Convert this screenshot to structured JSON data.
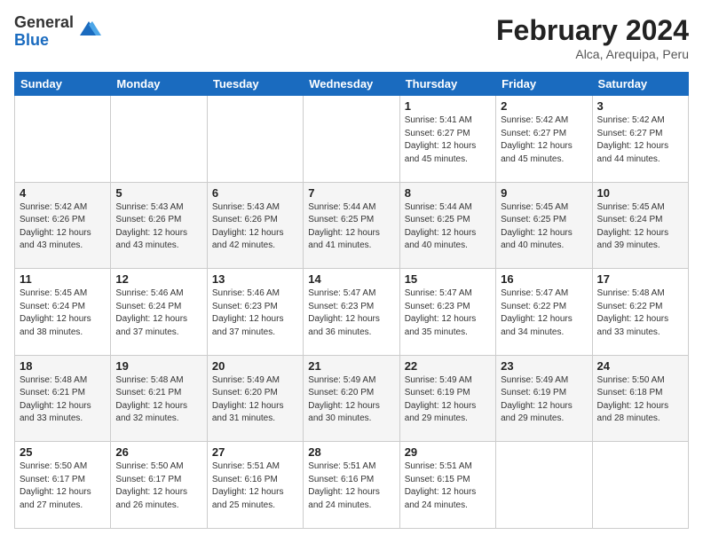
{
  "logo": {
    "general": "General",
    "blue": "Blue"
  },
  "title": "February 2024",
  "subtitle": "Alca, Arequipa, Peru",
  "days_of_week": [
    "Sunday",
    "Monday",
    "Tuesday",
    "Wednesday",
    "Thursday",
    "Friday",
    "Saturday"
  ],
  "weeks": [
    [
      {
        "day": "",
        "info": ""
      },
      {
        "day": "",
        "info": ""
      },
      {
        "day": "",
        "info": ""
      },
      {
        "day": "",
        "info": ""
      },
      {
        "day": "1",
        "info": "Sunrise: 5:41 AM\nSunset: 6:27 PM\nDaylight: 12 hours\nand 45 minutes."
      },
      {
        "day": "2",
        "info": "Sunrise: 5:42 AM\nSunset: 6:27 PM\nDaylight: 12 hours\nand 45 minutes."
      },
      {
        "day": "3",
        "info": "Sunrise: 5:42 AM\nSunset: 6:27 PM\nDaylight: 12 hours\nand 44 minutes."
      }
    ],
    [
      {
        "day": "4",
        "info": "Sunrise: 5:42 AM\nSunset: 6:26 PM\nDaylight: 12 hours\nand 43 minutes."
      },
      {
        "day": "5",
        "info": "Sunrise: 5:43 AM\nSunset: 6:26 PM\nDaylight: 12 hours\nand 43 minutes."
      },
      {
        "day": "6",
        "info": "Sunrise: 5:43 AM\nSunset: 6:26 PM\nDaylight: 12 hours\nand 42 minutes."
      },
      {
        "day": "7",
        "info": "Sunrise: 5:44 AM\nSunset: 6:25 PM\nDaylight: 12 hours\nand 41 minutes."
      },
      {
        "day": "8",
        "info": "Sunrise: 5:44 AM\nSunset: 6:25 PM\nDaylight: 12 hours\nand 40 minutes."
      },
      {
        "day": "9",
        "info": "Sunrise: 5:45 AM\nSunset: 6:25 PM\nDaylight: 12 hours\nand 40 minutes."
      },
      {
        "day": "10",
        "info": "Sunrise: 5:45 AM\nSunset: 6:24 PM\nDaylight: 12 hours\nand 39 minutes."
      }
    ],
    [
      {
        "day": "11",
        "info": "Sunrise: 5:45 AM\nSunset: 6:24 PM\nDaylight: 12 hours\nand 38 minutes."
      },
      {
        "day": "12",
        "info": "Sunrise: 5:46 AM\nSunset: 6:24 PM\nDaylight: 12 hours\nand 37 minutes."
      },
      {
        "day": "13",
        "info": "Sunrise: 5:46 AM\nSunset: 6:23 PM\nDaylight: 12 hours\nand 37 minutes."
      },
      {
        "day": "14",
        "info": "Sunrise: 5:47 AM\nSunset: 6:23 PM\nDaylight: 12 hours\nand 36 minutes."
      },
      {
        "day": "15",
        "info": "Sunrise: 5:47 AM\nSunset: 6:23 PM\nDaylight: 12 hours\nand 35 minutes."
      },
      {
        "day": "16",
        "info": "Sunrise: 5:47 AM\nSunset: 6:22 PM\nDaylight: 12 hours\nand 34 minutes."
      },
      {
        "day": "17",
        "info": "Sunrise: 5:48 AM\nSunset: 6:22 PM\nDaylight: 12 hours\nand 33 minutes."
      }
    ],
    [
      {
        "day": "18",
        "info": "Sunrise: 5:48 AM\nSunset: 6:21 PM\nDaylight: 12 hours\nand 33 minutes."
      },
      {
        "day": "19",
        "info": "Sunrise: 5:48 AM\nSunset: 6:21 PM\nDaylight: 12 hours\nand 32 minutes."
      },
      {
        "day": "20",
        "info": "Sunrise: 5:49 AM\nSunset: 6:20 PM\nDaylight: 12 hours\nand 31 minutes."
      },
      {
        "day": "21",
        "info": "Sunrise: 5:49 AM\nSunset: 6:20 PM\nDaylight: 12 hours\nand 30 minutes."
      },
      {
        "day": "22",
        "info": "Sunrise: 5:49 AM\nSunset: 6:19 PM\nDaylight: 12 hours\nand 29 minutes."
      },
      {
        "day": "23",
        "info": "Sunrise: 5:49 AM\nSunset: 6:19 PM\nDaylight: 12 hours\nand 29 minutes."
      },
      {
        "day": "24",
        "info": "Sunrise: 5:50 AM\nSunset: 6:18 PM\nDaylight: 12 hours\nand 28 minutes."
      }
    ],
    [
      {
        "day": "25",
        "info": "Sunrise: 5:50 AM\nSunset: 6:17 PM\nDaylight: 12 hours\nand 27 minutes."
      },
      {
        "day": "26",
        "info": "Sunrise: 5:50 AM\nSunset: 6:17 PM\nDaylight: 12 hours\nand 26 minutes."
      },
      {
        "day": "27",
        "info": "Sunrise: 5:51 AM\nSunset: 6:16 PM\nDaylight: 12 hours\nand 25 minutes."
      },
      {
        "day": "28",
        "info": "Sunrise: 5:51 AM\nSunset: 6:16 PM\nDaylight: 12 hours\nand 24 minutes."
      },
      {
        "day": "29",
        "info": "Sunrise: 5:51 AM\nSunset: 6:15 PM\nDaylight: 12 hours\nand 24 minutes."
      },
      {
        "day": "",
        "info": ""
      },
      {
        "day": "",
        "info": ""
      }
    ]
  ]
}
